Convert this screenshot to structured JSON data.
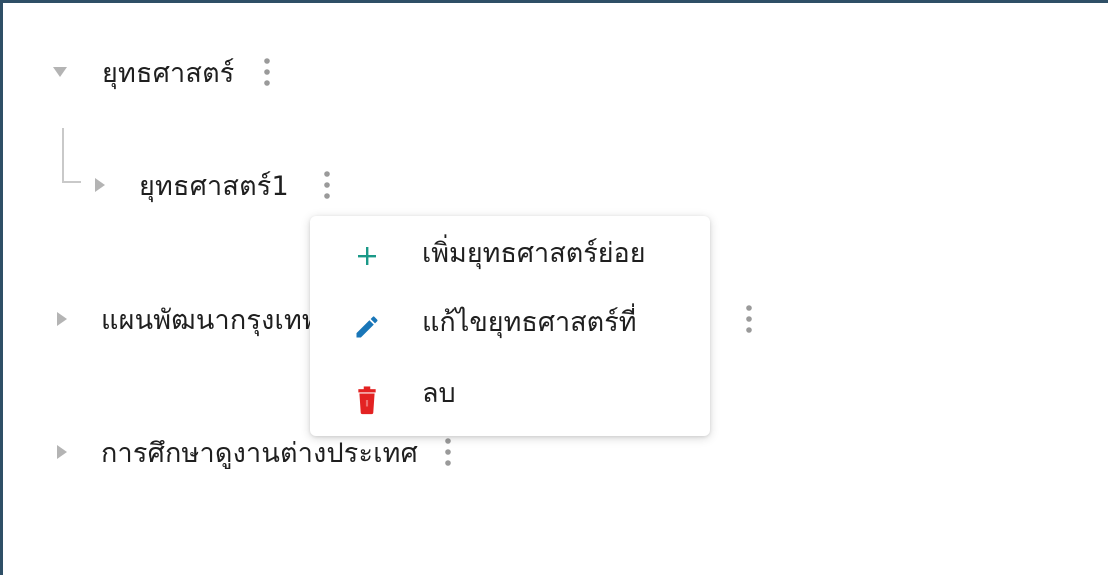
{
  "tree": {
    "items": [
      {
        "label": "ยุทธศาสตร์",
        "expanded": true,
        "toggle_icon": "triangle-down-icon"
      },
      {
        "label": "ยุทธศาสตร์1",
        "expanded": false,
        "toggle_icon": "triangle-right-icon"
      },
      {
        "label": "แผนพัฒนากรุงเทพ",
        "expanded": false,
        "toggle_icon": "triangle-right-icon"
      },
      {
        "label": "การศึกษาดูงานต่างประเทศ",
        "expanded": false,
        "toggle_icon": "triangle-right-icon"
      }
    ]
  },
  "context_menu": {
    "items": [
      {
        "label": "เพิ่มยุทธศาสตร์ย่อย",
        "icon": "plus-icon",
        "color": "#1a9988"
      },
      {
        "label": "แก้ไขยุทธศาสตร์ที่",
        "icon": "pencil-icon",
        "color": "#1976b8"
      },
      {
        "label": "ลบ",
        "icon": "trash-icon",
        "color": "#e32222"
      }
    ]
  },
  "colors": {
    "frame_border": "#2f4f66",
    "toggle": "#b4b4b4",
    "kebab": "#9a9a9a",
    "text": "#1f1f1f"
  }
}
